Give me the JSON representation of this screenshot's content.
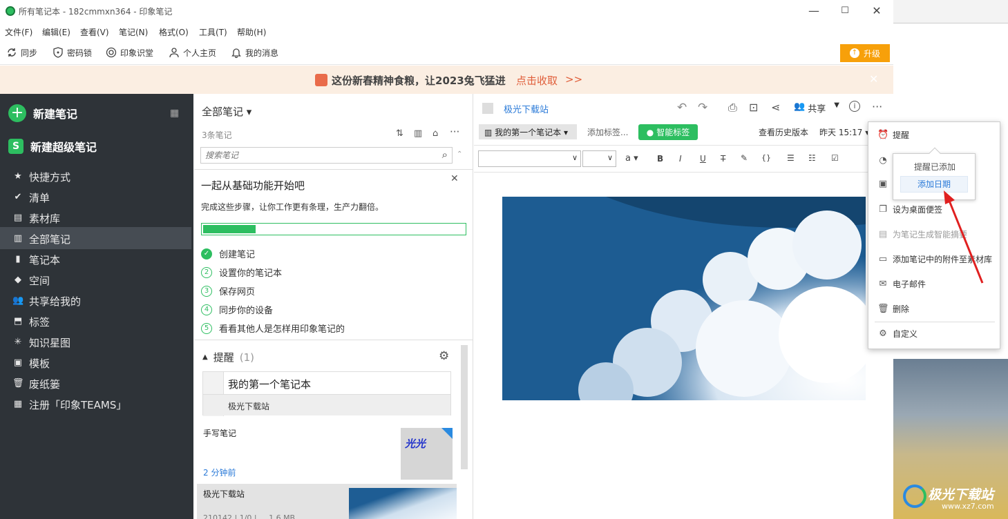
{
  "window": {
    "title": "所有笔记本 - 182cmmxn364 - 印象笔记",
    "min": "—",
    "max": "☐",
    "close": "✕"
  },
  "menubar": [
    "文件(F)",
    "编辑(E)",
    "查看(V)",
    "笔记(N)",
    "格式(O)",
    "工具(T)",
    "帮助(H)"
  ],
  "toolbar": {
    "sync": "同步",
    "lock": "密码锁",
    "class": "印象识堂",
    "home": "个人主页",
    "msg": "我的消息",
    "upgrade": "升级"
  },
  "banner": {
    "text": "这份新春精神食粮，让2023兔飞猛进",
    "cta": "点击收取",
    "arrows": ">>"
  },
  "sidebar": {
    "new_note": "新建笔记",
    "new_super": "新建超级笔记",
    "items": [
      "快捷方式",
      "清单",
      "素材库",
      "全部笔记",
      "笔记本",
      "空间",
      "共享给我的",
      "标签",
      "知识星图",
      "模板",
      "废纸篓",
      "注册「印象TEAMS」"
    ]
  },
  "notelist": {
    "header": "全部笔记",
    "count": "3条笔记",
    "search_placeholder": "搜索笔记",
    "guide_title": "一起从基础功能开始吧",
    "guide_sub": "完成这些步骤，让你工作更有条理，生产力翻倍。",
    "progress": 0.2,
    "steps": [
      {
        "n": "✓",
        "t": "创建笔记"
      },
      {
        "n": "2",
        "t": "设置你的笔记本"
      },
      {
        "n": "3",
        "t": "保存网页"
      },
      {
        "n": "4",
        "t": "同步你的设备"
      },
      {
        "n": "5",
        "t": "看看其他人是怎样用印象笔记的"
      }
    ],
    "reminder_label": "提醒",
    "reminder_count": "(1)",
    "reminder_nb": "我的第一个笔记本",
    "reminder_note": "极光下载站",
    "note1_title": "手写笔记",
    "note1_time": "2 分钟前",
    "note2_title": "极光下载站",
    "note2_meta": "210142 | 1/0 | ... 1.6 MB"
  },
  "editor": {
    "title": "极光下载站",
    "share": "共享",
    "notebook": "我的第一个笔记本",
    "add_tag": "添加标签...",
    "smart_tag": "智能标签",
    "history": "查看历史版本",
    "time": "昨天 15:17"
  },
  "menu": {
    "items": [
      "提醒",
      "设为桌面便签",
      "为笔记生成智能摘要",
      "添加笔记中的附件至素材库",
      "电子邮件",
      "删除",
      "自定义"
    ],
    "popup_title": "提醒已添加",
    "popup_btn": "添加日期"
  },
  "watermark": "极光下载站",
  "watermark_url": "www.xz7.com",
  "colors": {
    "accent": "#2dbe60",
    "upgrade": "#f7a00a",
    "sidebar": "#2e3338",
    "link": "#2a7ad8"
  }
}
